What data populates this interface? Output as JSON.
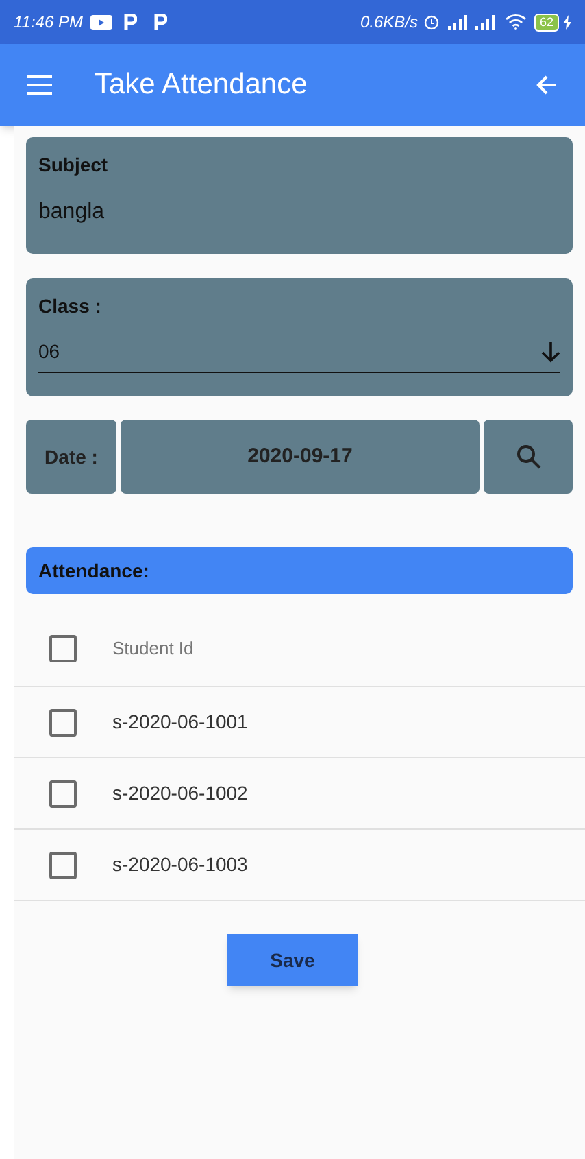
{
  "status_bar": {
    "time": "11:46 PM",
    "speed": "0.6KB/s",
    "battery": "62"
  },
  "app_bar": {
    "title": "Take Attendance"
  },
  "subject": {
    "label": "Subject",
    "value": "bangla"
  },
  "class_field": {
    "label": "Class :",
    "value": "06"
  },
  "date": {
    "label": "Date :",
    "value": "2020-09-17"
  },
  "attendance": {
    "title": "Attendance:",
    "header": {
      "label": "Student Id",
      "checked": false
    },
    "rows": [
      {
        "id": "s-2020-06-1001",
        "checked": false
      },
      {
        "id": "s-2020-06-1002",
        "checked": false
      },
      {
        "id": "s-2020-06-1003",
        "checked": false
      }
    ]
  },
  "save_button": "Save"
}
